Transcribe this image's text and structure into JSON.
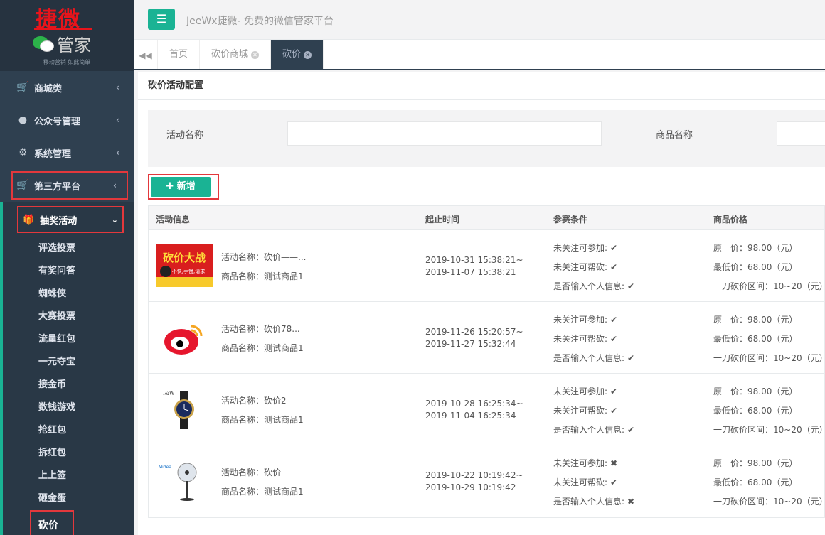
{
  "logo": {
    "top_text": "捷微",
    "bottom_text": "管家",
    "slogan": "移动营销  如此简单"
  },
  "header": {
    "title": "JeeWx捷微- 免费的微信管家平台"
  },
  "sidebar": {
    "items": [
      {
        "label": "商城类"
      },
      {
        "label": "公众号管理"
      },
      {
        "label": "系统管理"
      },
      {
        "label": "第三方平台"
      }
    ],
    "active_group": "抽奖活动",
    "sub_items": [
      "评选投票",
      "有奖问答",
      "蜘蛛侠",
      "大赛投票",
      "流量红包",
      "一元夺宝",
      "接金币",
      "数钱游戏",
      "抢红包",
      "拆红包",
      "上上签",
      "砸金蛋"
    ],
    "current": "砍价"
  },
  "tabs": [
    {
      "label": "首页"
    },
    {
      "label": "砍价商城"
    },
    {
      "label": "砍价"
    }
  ],
  "page": {
    "title": "砍价活动配置",
    "search": {
      "label_activity": "活动名称",
      "label_goods": "商品名称"
    },
    "add_button": "新增"
  },
  "table": {
    "headers": [
      "活动信息",
      "起止时间",
      "参赛条件",
      "商品价格"
    ],
    "rows": [
      {
        "name": "活动名称：砍价——...",
        "goods": "商品名称：测试商品1",
        "start": "2019-10-31 15:38:21~",
        "end": "2019-11-07 15:38:21",
        "c1": "未关注可参加:",
        "m1": "✔",
        "c2": "未关注可帮砍:",
        "m2": "✔",
        "c3": "是否输入个人信息:",
        "m3": "✔",
        "p1": "原　价：98.00（元）",
        "p2": "最低价：68.00（元）",
        "p3": "一刀砍价区间：10~20（元）"
      },
      {
        "name": "活动名称：砍价78...",
        "goods": "商品名称：测试商品1",
        "start": "2019-11-26 15:20:57~",
        "end": "2019-11-27 15:32:44",
        "c1": "未关注可参加:",
        "m1": "✔",
        "c2": "未关注可帮砍:",
        "m2": "✔",
        "c3": "是否输入个人信息:",
        "m3": "✔",
        "p1": "原　价：98.00（元）",
        "p2": "最低价：68.00（元）",
        "p3": "一刀砍价区间：10~20（元）"
      },
      {
        "name": "活动名称：砍价2",
        "goods": "商品名称：测试商品1",
        "start": "2019-10-28 16:25:34~",
        "end": "2019-11-04 16:25:34",
        "c1": "未关注可参加:",
        "m1": "✔",
        "c2": "未关注可帮砍:",
        "m2": "✔",
        "c3": "是否输入个人信息:",
        "m3": "✔",
        "p1": "原　价：98.00（元）",
        "p2": "最低价：68.00（元）",
        "p3": "一刀砍价区间：10~20（元）"
      },
      {
        "name": "活动名称：砍价",
        "goods": "商品名称：测试商品1",
        "start": "2019-10-22 10:19:42~",
        "end": "2019-10-29 10:19:42",
        "c1": "未关注可参加:",
        "m1": "✖",
        "c2": "未关注可帮砍:",
        "m2": "✔",
        "c3": "是否输入个人信息:",
        "m3": "✖",
        "p1": "原　价：98.00（元）",
        "p2": "最低价：68.00（元）",
        "p3": "一刀砍价区间：10~20（元）"
      }
    ]
  },
  "thumb_texts": {
    "banner": "砍价大战",
    "banner_sub": "不快,手慢,请求",
    "watch": "I&W",
    "fan": "Midea"
  }
}
